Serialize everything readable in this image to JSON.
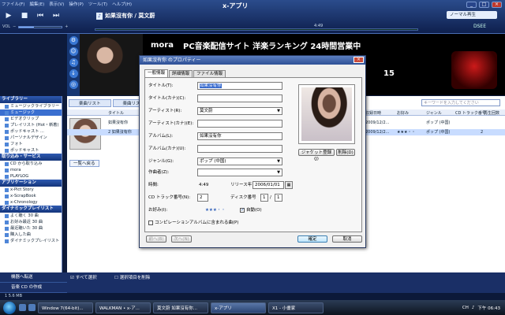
{
  "app": {
    "title": "x-アプリ",
    "menu": [
      "ファイル(F)",
      "編集(E)",
      "表示(V)",
      "操作(P)",
      "ツール(T)",
      "ヘルプ(H)"
    ],
    "now_playing": "如果沒有你 / 莫文蔚",
    "volume_label": "VOL",
    "volume_level": 0.35,
    "time": "4:49",
    "playback_mode": "ノーマル再生",
    "dsee_label": "DSEE",
    "controls": {
      "play": "▶",
      "stop": "■",
      "prev": "⏮",
      "next": "⏭"
    }
  },
  "banner": {
    "brand": "mora",
    "headline": "PC音楽配信サイト 洋楽ランキング 24時間営業中",
    "rank_number": "15"
  },
  "sidebar": {
    "sections": [
      {
        "title": "ライブラリー",
        "items": [
          "ミュージックライブラリー",
          "ミュージック",
          "ビデオクリップ",
          "プレイリスト (Hot・新着)",
          "ポッドキャスト ...",
          "パーソナルデザイン",
          "フォト",
          "ポッドキャスト"
        ]
      },
      {
        "title": "取り込み・サービス",
        "items": [
          "CD から取り込み",
          "mora",
          "PLAYLOG",
          "アプリケーション"
        ]
      },
      {
        "title": "アプリケーション",
        "items": [
          "x-Pict Story",
          "x-ScrapBook",
          "x-Chronology"
        ]
      },
      {
        "title": "ダイナミックプレイリスト",
        "items": [
          "よく聴く 30 曲",
          "お好み最近 30 曲",
          "最近聴いた 30 曲",
          "購入した曲",
          "ダイナミックプレイリスト"
        ]
      }
    ],
    "footer": {
      "transfer": "機器へ転送",
      "create_cd": "音楽 CD の作成"
    }
  },
  "main": {
    "tabs": [
      "楽曲リスト",
      "楽曲リスト"
    ],
    "search_placeholder": "キーワードを入力してください",
    "columns": [
      "タイトル",
      "ジャンル",
      "収録日時",
      "お好み",
      "評価",
      "ジャンル",
      "CD トラック番号",
      "再生回数"
    ],
    "rows": [
      {
        "title": "如果沒有你",
        "date": "2009/12/2...",
        "genre": "ポップ (中国)",
        "rating": "",
        "track": "",
        "count": ""
      },
      {
        "title": "2 如果沒有你",
        "date": "2009/12/2...",
        "genre": "ポップ (中国)",
        "rating": "★★★・・",
        "track": "2",
        "count": ""
      }
    ],
    "back_label": "一覧へ戻る"
  },
  "actionbar": {
    "select_all": "すべて選択",
    "delete_selected": "選択項目を削除",
    "status": "1  5.6 MB"
  },
  "dialog": {
    "title": "如果沒有你 のプロパティー",
    "tabs": [
      "一般情報",
      "詳細情報",
      "ファイル情報"
    ],
    "fields": {
      "title_label": "タイトル(T):",
      "title_value": "如果沒有你",
      "title_kana_label": "タイトル(カナ)(C):",
      "title_kana_value": "",
      "artist_label": "アーティスト(R):",
      "artist_value": "莫文蔚",
      "artist_kana_label": "アーティスト(カナ)(E):",
      "artist_kana_value": "",
      "album_label": "アルバム(L):",
      "album_value": "如果沒有你",
      "album_kana_label": "アルバム(カナ)(U):",
      "album_kana_value": "",
      "genre_label": "ジャンル(G):",
      "genre_value": "ポップ (中国)",
      "composer_label": "作曲者(Z):",
      "composer_value": "",
      "duration_label": "時間:",
      "duration_value": "4:49",
      "release_label": "リリース年",
      "release_value": "2006/01/01",
      "cd_track_label": "CD トラック番号(N):",
      "cd_track_value": "2",
      "disc_label": "ディスク番号",
      "disc_value": "1",
      "disc_total": "1",
      "rating_label": "お好み(I):",
      "rating_stars": "★★★・・",
      "auto_label": "自動(O)",
      "compilation_label": "コンピレーションアルバムに含まれる曲(P)"
    },
    "jacket_register": "ジャケット登録(J)",
    "jacket_delete": "削除(D)",
    "prev_btn": "前へ(B)",
    "next_btn": "次へ(N)",
    "ok_btn": "確定",
    "cancel_btn": "取消"
  },
  "taskbar": {
    "tasks": [
      "Window 7(64-bit)...",
      "WALKMAN • x-ア...",
      "莫文蔚 如果沒有你...",
      "x-アプリ",
      "X1 - 小畫家"
    ],
    "language": "CH",
    "clock": "下午 06:43"
  }
}
